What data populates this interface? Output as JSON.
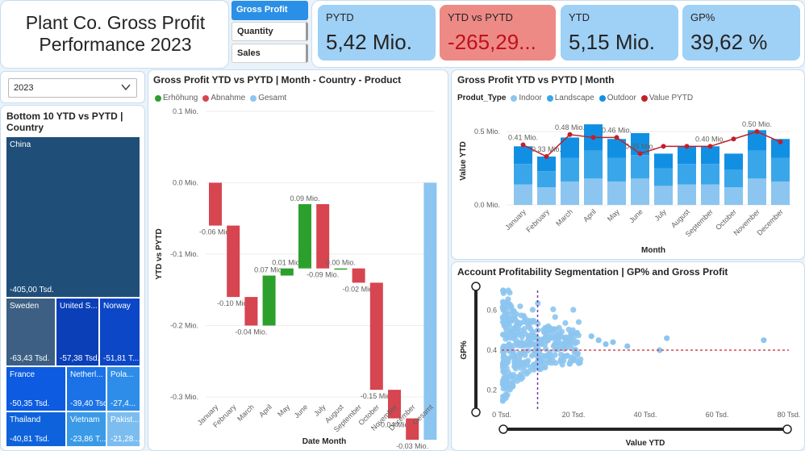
{
  "header": {
    "title_line1": "Plant Co. Gross Profit",
    "title_line2": "Performance 2023"
  },
  "nav": {
    "items": [
      "Gross Profit",
      "Quantity",
      "Sales"
    ]
  },
  "kpis": [
    {
      "label": "PYTD",
      "value": "5,42 Mio."
    },
    {
      "label": "YTD vs PYTD",
      "value": "-265,29..."
    },
    {
      "label": "YTD",
      "value": "5,15 Mio."
    },
    {
      "label": "GP%",
      "value": "39,62 %"
    }
  ],
  "year_filter": {
    "value": "2023"
  },
  "treemap": {
    "title": "Bottom 10 YTD vs PYTD | Country",
    "cells": [
      {
        "name": "China",
        "value": "-405,00 Tsd.",
        "color": "#1f4e79"
      },
      {
        "name": "Sweden",
        "value": "-63,43 Tsd.",
        "color": "#3c5f83"
      },
      {
        "name": "United S...",
        "value": "-57,38 Tsd.",
        "color": "#0a3fb8"
      },
      {
        "name": "Norway",
        "value": "-51,81 T...",
        "color": "#0c47c7"
      },
      {
        "name": "France",
        "value": "-50,35 Tsd.",
        "color": "#0d5be0"
      },
      {
        "name": "Netherl...",
        "value": "-39,40 Tsd.",
        "color": "#1a72e6"
      },
      {
        "name": "Pola...",
        "value": "-27,4...",
        "color": "#2e8de8"
      },
      {
        "name": "Thailand",
        "value": "-40,81 Tsd.",
        "color": "#0e63dc"
      },
      {
        "name": "Vietnam",
        "value": "-23,86 T...",
        "color": "#3a9ae8"
      },
      {
        "name": "Pakist...",
        "value": "-21,28...",
        "color": "#7cbdf0"
      }
    ]
  },
  "waterfall": {
    "title": "Gross Profit YTD vs PYTD | Month - Country - Product",
    "legend": [
      "Erhöhung",
      "Abnahme",
      "Gesamt"
    ],
    "colors": {
      "increase": "#2ca02c",
      "decrease": "#d64550",
      "total": "#8cc5f0"
    },
    "ylabel": "YTD vs PYTD",
    "xlabel": "Date Month",
    "yticks": [
      "0.1 Mio.",
      "0.0 Mio.",
      "-0.1 Mio.",
      "-0.2 Mio.",
      "-0.3 Mio."
    ]
  },
  "chart_data": [
    {
      "type": "bar",
      "subtype": "waterfall",
      "title": "Gross Profit YTD vs PYTD | Month - Country - Product",
      "categories": [
        "January",
        "February",
        "March",
        "April",
        "May",
        "June",
        "July",
        "August",
        "September",
        "October",
        "November",
        "December",
        "Gesamt"
      ],
      "values": [
        -0.06,
        -0.1,
        -0.04,
        0.07,
        0.01,
        0.09,
        -0.09,
        0.0,
        -0.02,
        -0.15,
        -0.04,
        -0.03,
        -0.27
      ],
      "data_labels": [
        "-0.06 Mio.",
        "-0.10 Mio.",
        "-0.04 Mio.",
        "0.07 Mio.",
        "0.01 Mio.",
        "0.09 Mio.",
        "-0.09 Mio.",
        "0.00 Mio.",
        "-0.02 Mio.",
        "-0.15 Mio.",
        "-0.04 Mio.",
        "-0.03 Mio.",
        ""
      ],
      "xlabel": "Date Month",
      "ylabel": "YTD vs PYTD",
      "ylim": [
        -0.3,
        0.1
      ]
    },
    {
      "type": "bar",
      "subtype": "stacked-bar-with-line",
      "title": "Gross Profit YTD vs PYTD | Month",
      "categories": [
        "January",
        "February",
        "March",
        "April",
        "May",
        "June",
        "July",
        "August",
        "September",
        "October",
        "November",
        "December"
      ],
      "legend_title": "Produt_Type",
      "series": [
        {
          "name": "Indoor",
          "color": "#8cc5f0",
          "values": [
            0.14,
            0.12,
            0.16,
            0.18,
            0.16,
            0.18,
            0.13,
            0.14,
            0.14,
            0.12,
            0.18,
            0.16
          ]
        },
        {
          "name": "Landscape",
          "color": "#3aa6ea",
          "values": [
            0.14,
            0.11,
            0.16,
            0.19,
            0.16,
            0.16,
            0.12,
            0.14,
            0.14,
            0.12,
            0.19,
            0.16
          ]
        },
        {
          "name": "Outdoor",
          "color": "#1190e3",
          "values": [
            0.12,
            0.1,
            0.14,
            0.18,
            0.13,
            0.15,
            0.1,
            0.12,
            0.12,
            0.11,
            0.14,
            0.13
          ]
        },
        {
          "name": "Value PYTD",
          "color": "#c0202a",
          "values": [
            0.41,
            0.33,
            0.48,
            0.46,
            0.46,
            0.35,
            0.4,
            0.4,
            0.4,
            0.45,
            0.5,
            0.43
          ]
        }
      ],
      "point_labels": [
        "0.41 Mio.",
        "0.33 Mio.",
        "0.48 Mio.",
        "",
        "0.46 Mio.",
        "0.35 Mio.",
        "",
        "",
        "0.40 Mio.",
        "",
        "0.50 Mio.",
        ""
      ],
      "xlabel": "Month",
      "ylabel": "Value YTD",
      "yticks": [
        "0.5 Mio.",
        "0.0 Mio."
      ],
      "ylim": [
        0,
        0.6
      ]
    },
    {
      "type": "scatter",
      "title": "Account Profitability Segmentation | GP% and Gross Profit",
      "xlabel": "Value YTD",
      "ylabel": "GP%",
      "xticks": [
        "0 Tsd.",
        "20 Tsd.",
        "40 Tsd.",
        "60 Tsd.",
        "80 Tsd."
      ],
      "yticks": [
        "0.6",
        "0.4",
        "0.2"
      ],
      "xlim": [
        0,
        80
      ],
      "ylim": [
        0.1,
        0.7
      ],
      "reference_lines": {
        "x": 10,
        "y": 0.4
      },
      "point_color": "#8cc5f0",
      "approx_points": 400
    }
  ],
  "bar_line": {
    "title": "Gross Profit YTD vs PYTD | Month",
    "legend_title": "Produt_Type",
    "legend": [
      {
        "name": "Indoor",
        "color": "#8cc5f0"
      },
      {
        "name": "Landscape",
        "color": "#3aa6ea"
      },
      {
        "name": "Outdoor",
        "color": "#1190e3"
      },
      {
        "name": "Value PYTD",
        "color": "#c0202a"
      }
    ],
    "ylabel": "Value YTD",
    "xlabel": "Month"
  },
  "scatter": {
    "title": "Account Profitability Segmentation | GP% and Gross Profit",
    "xlabel": "Value YTD",
    "ylabel": "GP%"
  }
}
